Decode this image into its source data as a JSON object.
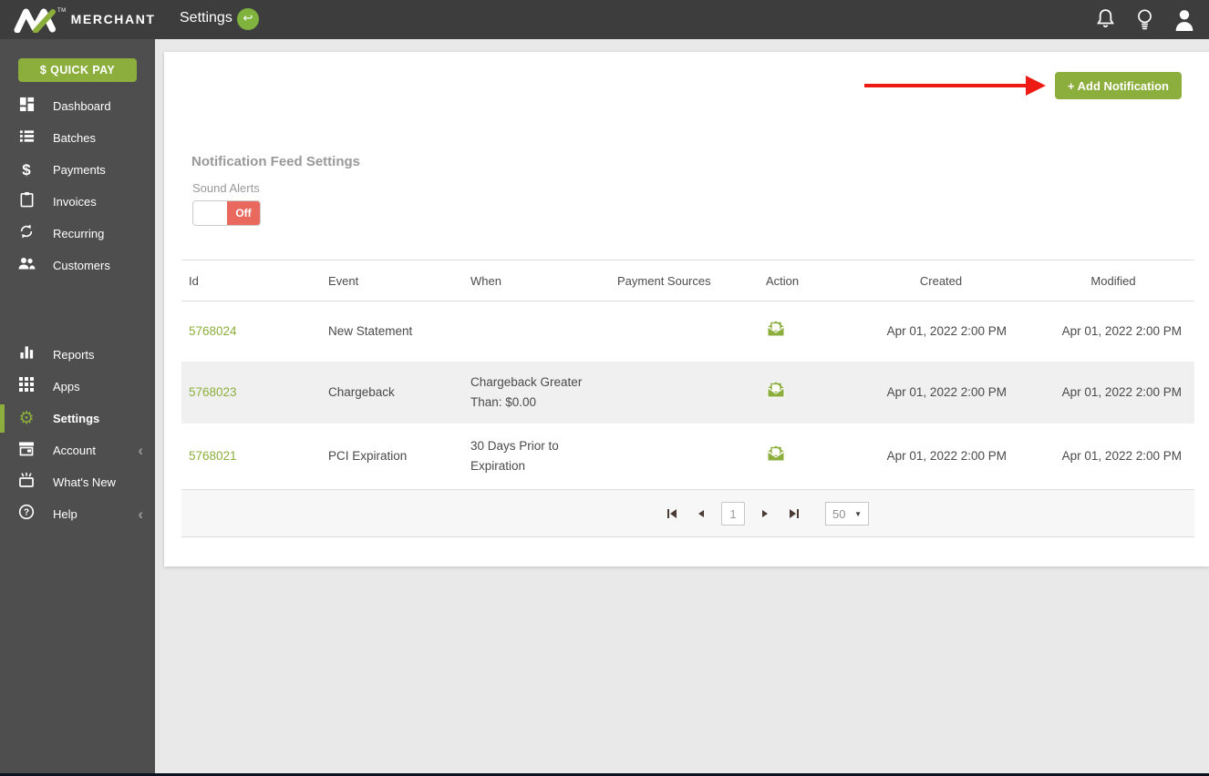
{
  "topbar": {
    "brand_tm": "TM",
    "brand_name": "MERCHANT",
    "page_title": "Settings"
  },
  "sidebar": {
    "quick_pay": "$ QUICK PAY",
    "items": [
      {
        "label": "Dashboard"
      },
      {
        "label": "Batches"
      },
      {
        "label": "Payments"
      },
      {
        "label": "Invoices"
      },
      {
        "label": "Recurring"
      },
      {
        "label": "Customers"
      },
      {
        "label": "Reports"
      },
      {
        "label": "Apps"
      },
      {
        "label": "Settings",
        "active": true
      },
      {
        "label": "Account",
        "has_submenu": true
      },
      {
        "label": "What's New"
      },
      {
        "label": "Help",
        "has_submenu": true
      }
    ]
  },
  "main": {
    "add_notification_button": "+ Add Notification",
    "section_title": "Notification Feed Settings",
    "sound_alerts": {
      "label": "Sound Alerts",
      "state": "Off"
    },
    "table": {
      "columns": [
        "Id",
        "Event",
        "When",
        "Payment Sources",
        "Action",
        "Created",
        "Modified"
      ],
      "rows": [
        {
          "id": "5768024",
          "event": "New Statement",
          "when": "",
          "payment_sources": "",
          "created": "Apr 01, 2022 2:00 PM",
          "modified": "Apr 01, 2022 2:00 PM"
        },
        {
          "id": "5768023",
          "event": "Chargeback",
          "when": "Chargeback Greater Than: $0.00",
          "payment_sources": "",
          "created": "Apr 01, 2022 2:00 PM",
          "modified": "Apr 01, 2022 2:00 PM"
        },
        {
          "id": "5768021",
          "event": "PCI Expiration",
          "when": "30 Days Prior to Expiration",
          "payment_sources": "",
          "created": "Apr 01, 2022 2:00 PM",
          "modified": "Apr 01, 2022 2:00 PM"
        }
      ]
    },
    "pagination": {
      "current_page": "1",
      "page_size": "50"
    }
  },
  "colors": {
    "brand_green": "#8cae3c",
    "toggle_off_red": "#e9695f",
    "arrow_red": "#ee1b15",
    "topbar_bg": "#3d3d3d",
    "sidebar_bg": "#4e4e4e"
  }
}
